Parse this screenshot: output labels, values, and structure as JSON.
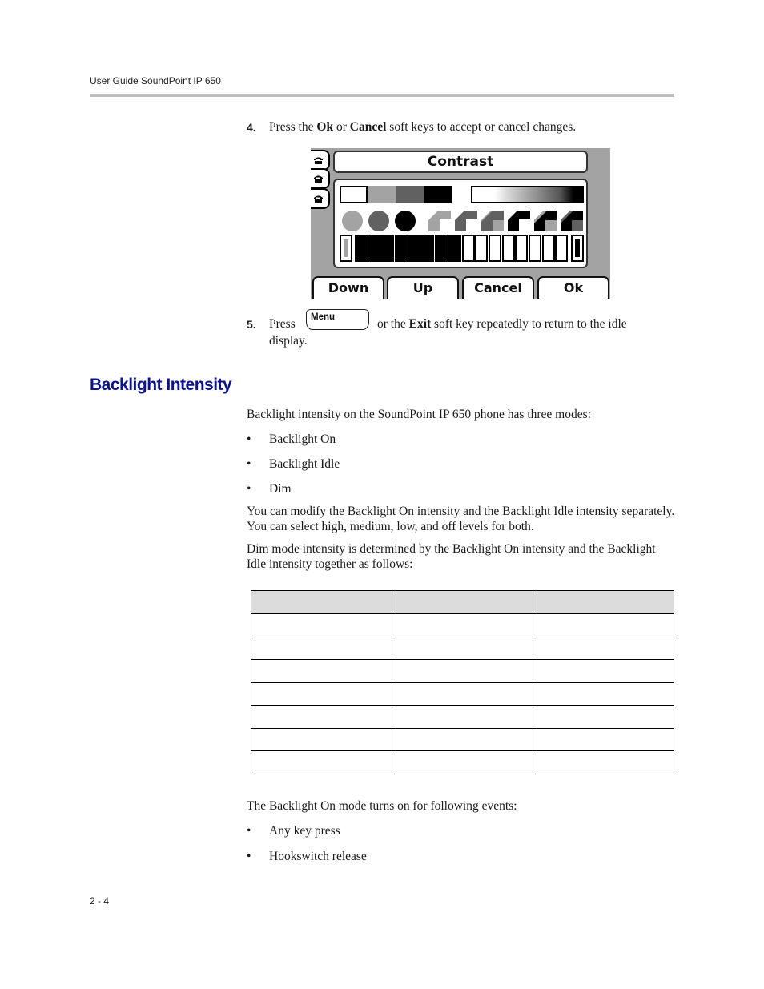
{
  "header": {
    "running_title": "User Guide SoundPoint IP 650"
  },
  "steps": [
    {
      "number": "4.",
      "parts": [
        "Press the ",
        "Ok",
        " or ",
        "Cancel",
        " soft keys to accept or cancel changes."
      ]
    },
    {
      "number": "5.",
      "pre": "Press",
      "key_label": "Menu",
      "mid": " or the ",
      "bold": "Exit",
      "post": " soft key repeatedly to return to the idle",
      "continuation": "display."
    }
  ],
  "phone_screen": {
    "title": "Contrast",
    "line_icons": [
      "handset-icon",
      "handset-icon",
      "handset-icon"
    ],
    "gray_levels": [
      "#ffffff",
      "#a3a3a3",
      "#616161",
      "#000000"
    ],
    "contrast_level": {
      "filled_bars": 8,
      "total_bars": 16
    },
    "softkeys": [
      "Down",
      "Up",
      "Cancel",
      "Ok"
    ]
  },
  "section": {
    "heading": "Backlight Intensity",
    "intro": "Backlight intensity on the SoundPoint IP 650 phone has three modes:",
    "modes": [
      "Backlight On",
      "Backlight Idle",
      "Dim"
    ],
    "para1": "You can modify the Backlight On intensity and the Backlight Idle intensity separately. You can select high, medium, low, and off levels for both.",
    "para2": "Dim mode intensity is determined by the Backlight On intensity and the Backlight Idle intensity together as follows:",
    "table": {
      "headers": [
        "",
        "",
        ""
      ],
      "rows": [
        [
          "",
          "",
          ""
        ],
        [
          "",
          "",
          ""
        ],
        [
          "",
          "",
          ""
        ],
        [
          "",
          "",
          ""
        ],
        [
          "",
          "",
          ""
        ],
        [
          "",
          "",
          ""
        ],
        [
          "",
          "",
          ""
        ]
      ]
    },
    "events_intro": "The Backlight On mode turns on for following events:",
    "events": [
      "Any key press",
      "Hookswitch release"
    ]
  },
  "footer": {
    "page_number": "2 - 4"
  },
  "colors": {
    "heading": "#0a128c",
    "rule": "#bdbdbd",
    "table_header_bg": "#dcdcdc",
    "lcd_bg": "#a3a3a3"
  }
}
